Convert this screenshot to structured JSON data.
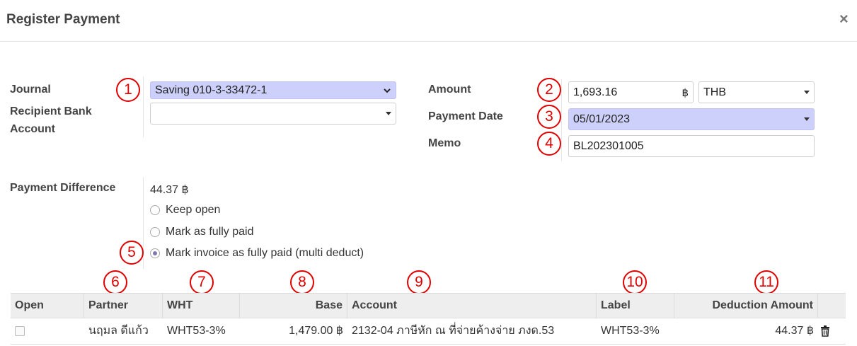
{
  "dialog": {
    "title": "Register Payment",
    "close_glyph": "×"
  },
  "markers": [
    "1",
    "2",
    "3",
    "4",
    "5",
    "6",
    "7",
    "8",
    "9",
    "10",
    "11"
  ],
  "form": {
    "journal": {
      "label": "Journal",
      "value": "Saving 010-3-33472-1"
    },
    "recipient_bank": {
      "label_line1": "Recipient Bank",
      "label_line2": "Account",
      "value": ""
    },
    "amount": {
      "label": "Amount",
      "value": "1,693.16",
      "currency_symbol": "฿",
      "currency": "THB"
    },
    "payment_date": {
      "label": "Payment Date",
      "value": "05/01/2023"
    },
    "memo": {
      "label": "Memo",
      "value": "BL202301005"
    },
    "payment_difference": {
      "label": "Payment Difference",
      "value": "44.37 ฿",
      "options": [
        {
          "label": "Keep open",
          "selected": false
        },
        {
          "label": "Mark as fully paid",
          "selected": false
        },
        {
          "label": "Mark invoice as fully paid (multi deduct)",
          "selected": true
        }
      ]
    }
  },
  "table": {
    "headers": {
      "open": "Open",
      "partner": "Partner",
      "wht": "WHT",
      "base": "Base",
      "account": "Account",
      "label": "Label",
      "deduction": "Deduction Amount"
    },
    "rows": [
      {
        "partner": "นฤมล ดีแก้ว",
        "wht": "WHT53-3%",
        "base": "1,479.00 ฿",
        "account": "2132-04 ภาษีหัก ณ ที่จ่ายค้างจ่าย ภงด.53",
        "label": "WHT53-3%",
        "deduction": "44.37 ฿"
      }
    ]
  },
  "colors": {
    "highlight": "#cdd0fa",
    "marker": "#e00000",
    "radio_selected": "#7c7bad"
  },
  "icons": {
    "close": "close-icon",
    "dropdown": "caret-down-icon",
    "chevron": "chevron-down-icon",
    "delete": "trash-icon"
  }
}
